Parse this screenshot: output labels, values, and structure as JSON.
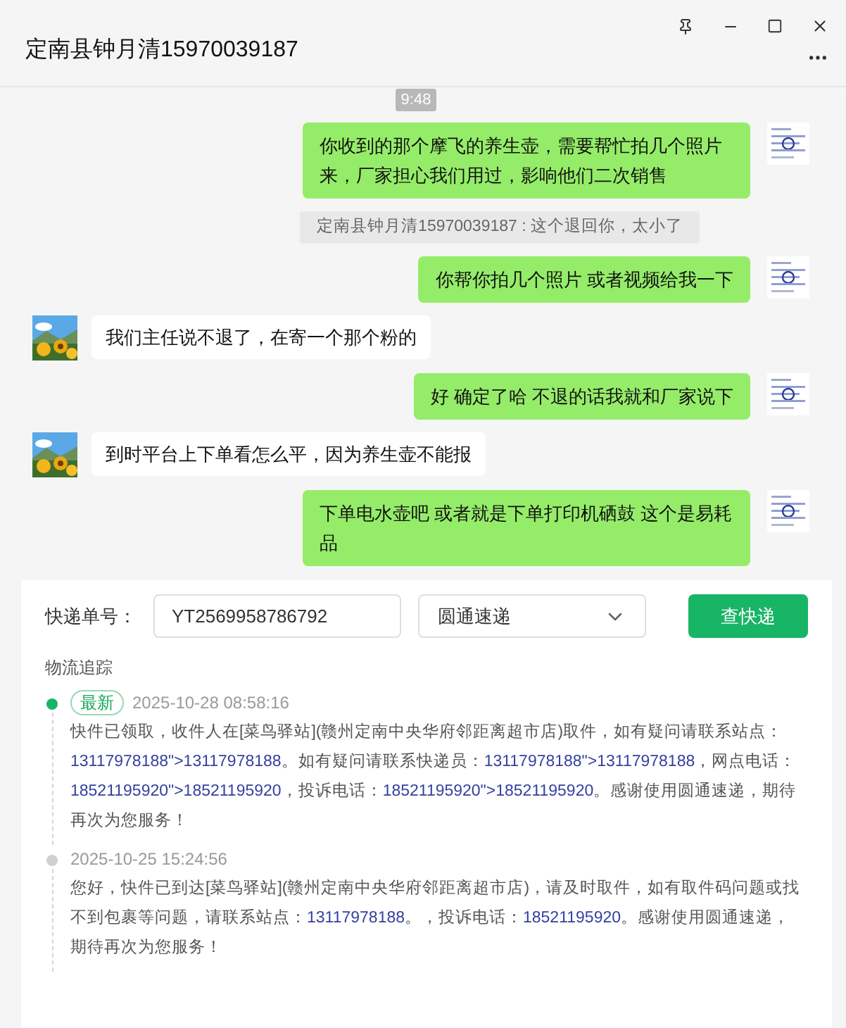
{
  "window": {
    "title": "定南县钟月清15970039187"
  },
  "chat": {
    "timestamp": "9:48",
    "messages": [
      {
        "kind": "sent",
        "text": "你收到的那个摩飞的养生壶，需要帮忙拍几个照片来，厂家担心我们用过，影响他们二次销售"
      },
      {
        "kind": "recall",
        "text": "定南县钟月清15970039187 : 这个退回你，太小了"
      },
      {
        "kind": "sent",
        "text": "你帮你拍几个照片  或者视频给我一下"
      },
      {
        "kind": "received",
        "text": "我们主任说不退了，在寄一个那个粉的"
      },
      {
        "kind": "sent",
        "text": "好  确定了哈  不退的话我就和厂家说下"
      },
      {
        "kind": "received",
        "text": "到时平台上下单看怎么平，因为养生壶不能报"
      },
      {
        "kind": "sent",
        "text": "下单电水壶吧   或者就是下单打印机硒鼓  这个是易耗品"
      }
    ]
  },
  "tracking": {
    "label": "快递单号：",
    "number": "YT2569958786792",
    "carrier": "圆通速递",
    "button": "查快递",
    "section_title": "物流追踪",
    "entries": [
      {
        "current": true,
        "badge": "最新",
        "time": "2025-10-28 08:58:16",
        "segments": [
          {
            "kind": "text",
            "text": "快件已领取，收件人在[菜鸟驿站](赣州定南中央华府邻距离超市店)取件，如有疑问请联系站点："
          },
          {
            "kind": "link",
            "text": "13117978188\">13117978188"
          },
          {
            "kind": "text",
            "text": "。如有疑问请联系快递员："
          },
          {
            "kind": "link",
            "text": "13117978188\">13117978188"
          },
          {
            "kind": "text",
            "text": "，网点电话："
          },
          {
            "kind": "link",
            "text": "18521195920\">18521195920"
          },
          {
            "kind": "text",
            "text": "，投诉电话："
          },
          {
            "kind": "link",
            "text": "18521195920\">18521195920"
          },
          {
            "kind": "text",
            "text": "。感谢使用圆通速递，期待再次为您服务！"
          }
        ]
      },
      {
        "current": false,
        "time": "2025-10-25 15:24:56",
        "segments": [
          {
            "kind": "text",
            "text": "您好，快件已到达[菜鸟驿站](赣州定南中央华府邻距离超市店)，请及时取件，如有取件码问题或找不到包裹等问题，请联系站点："
          },
          {
            "kind": "link",
            "text": "13117978188"
          },
          {
            "kind": "text",
            "text": "。，投诉电话："
          },
          {
            "kind": "link",
            "text": "18521195920"
          },
          {
            "kind": "text",
            "text": "。感谢使用圆通速递，期待再次为您服务！"
          }
        ]
      }
    ]
  }
}
